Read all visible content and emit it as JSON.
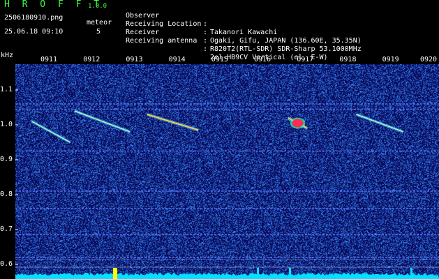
{
  "app": {
    "name": "H R O F F T",
    "version": "1.0.0",
    "filename": "2506180910.png",
    "datetime": "25.06.18 09:10",
    "meteor_label": "meteor",
    "meteor_count": "5"
  },
  "info": [
    {
      "label": "Observer",
      "value": "Takanori Kawachi"
    },
    {
      "label": "Receiving Location",
      "value": "Ogaki, Gifu, JAPAN (136.60E, 35.35N)"
    },
    {
      "label": "Receiver",
      "value": "R820T2(RTL-SDR) SDR-Sharp 53.1000MHz"
    },
    {
      "label": "Receiving antenna",
      "value": "2el-HB9CV Vertical (el. E-W)"
    }
  ],
  "colon": ":",
  "colors": {
    "background": "#000000",
    "plot_bg": "#0a0a5a",
    "noise": "#2a5cff",
    "header_green": "#3cff3c",
    "echo_hot": "#ff2a55",
    "carrier": "#5a7cff",
    "level_trace": "#00e0ff",
    "level_peak": "#ffff00"
  },
  "chart_data": {
    "type": "heatmap",
    "ylabel": "kHz",
    "y_ticks": [
      "1.1",
      "1.0",
      "0.9",
      "0.8",
      "0.7",
      "0.6"
    ],
    "x_ticks": [
      "0911",
      "0912",
      "0913",
      "0914",
      "0915",
      "0916",
      "0917",
      "0918",
      "0919",
      "0920"
    ],
    "xlim": [
      "09:10",
      "09:20"
    ],
    "ylim_khz": [
      0.58,
      1.18
    ],
    "carriers_khz": [
      1.06,
      1.045,
      0.925,
      0.81,
      0.76,
      0.685,
      0.62
    ],
    "meteor_echoes": [
      {
        "t_start": 0.6,
        "t_end": 1.5,
        "f_start": 1.01,
        "f_end": 0.95,
        "intensity": 0.7
      },
      {
        "t_start": 1.6,
        "t_end": 2.9,
        "f_start": 1.04,
        "f_end": 0.98,
        "intensity": 0.7
      },
      {
        "t_start": 3.3,
        "t_end": 4.5,
        "f_start": 1.03,
        "f_end": 0.985,
        "intensity": 0.9
      },
      {
        "t_start": 6.6,
        "t_end": 7.05,
        "f_start": 1.02,
        "f_end": 0.99,
        "intensity": 1.0
      },
      {
        "t_start": 8.2,
        "t_end": 9.3,
        "f_start": 1.03,
        "f_end": 0.98,
        "intensity": 0.8
      }
    ]
  }
}
